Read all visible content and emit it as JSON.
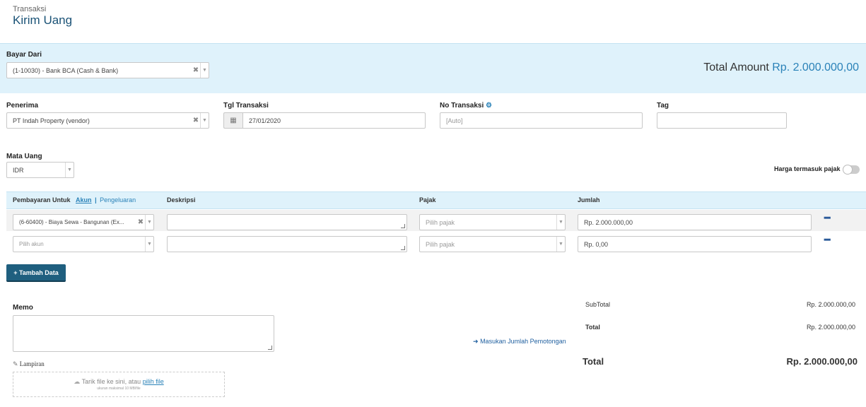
{
  "header": {
    "breadcrumb": "Transaksi",
    "title": "Kirim Uang"
  },
  "pay_from": {
    "label": "Bayar Dari",
    "value": "(1-10030) - Bank BCA (Cash & Bank)"
  },
  "total_amount": {
    "label": "Total Amount",
    "value": "Rp. 2.000.000,00"
  },
  "recipient": {
    "label": "Penerima",
    "value": "PT Indah Property (vendor)"
  },
  "date": {
    "label": "Tgl Transaksi",
    "value": "27/01/2020"
  },
  "trx_no": {
    "label": "No Transaksi",
    "placeholder": "[Auto]"
  },
  "tag": {
    "label": "Tag",
    "value": ""
  },
  "currency": {
    "label": "Mata Uang",
    "value": "IDR"
  },
  "tax_inclusive": {
    "label": "Harga termasuk pajak",
    "on": false
  },
  "table": {
    "col_payment": "Pembayaran Untuk",
    "tab_account": "Akun",
    "tab_sep": "|",
    "tab_expense": "Pengeluaran",
    "col_description": "Deskripsi",
    "col_tax": "Pajak",
    "col_amount": "Jumlah",
    "rows": [
      {
        "account": "(6-60400) - Biaya Sewa - Bangunan (Ex...",
        "description": "",
        "tax": "Pilih pajak",
        "amount": "Rp. 2.000.000,00"
      },
      {
        "account": "Pilih akun",
        "description": "",
        "tax": "Pilih pajak",
        "amount": "Rp. 0,00"
      }
    ]
  },
  "add_row_label": "+ Tambah Data",
  "memo": {
    "label": "Memo",
    "value": ""
  },
  "attachment": {
    "label": "Lampiran",
    "drop_text": "Tarik file ke sini, atau",
    "pick_link": "pilih file",
    "max_size": "ukuran maksimal 10 MB/file"
  },
  "deduction_link": "Masukan Jumlah Pemotongan",
  "summary": {
    "subtotal_label": "SubTotal",
    "subtotal_value": "Rp. 2.000.000,00",
    "total_label": "Total",
    "total_value": "Rp. 2.000.000,00",
    "grand_label": "Total",
    "grand_value": "Rp. 2.000.000,00"
  }
}
